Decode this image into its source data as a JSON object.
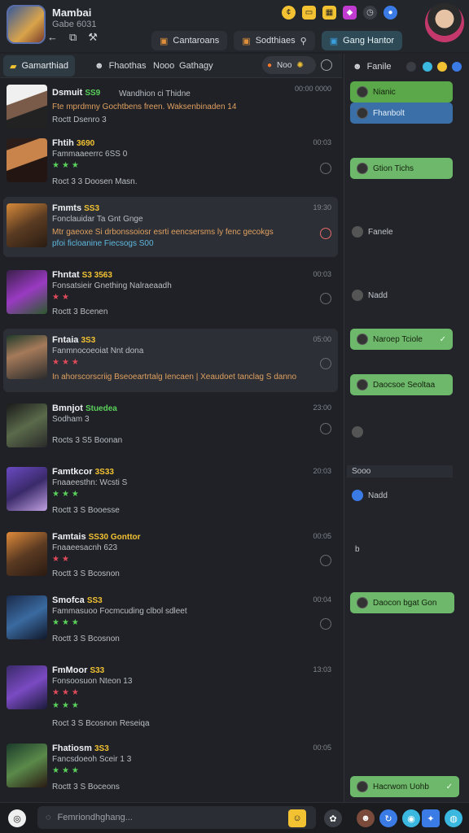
{
  "header": {
    "title": "Mambai",
    "subtitle": "Gabe 6031",
    "toolbar_icons": [
      "back-arrow-icon",
      "filter-icon",
      "hammer-icon"
    ],
    "top_icons": [
      {
        "name": "coin-icon",
        "color": "#f2c233"
      },
      {
        "name": "inbox-icon",
        "color": "#f2c233"
      },
      {
        "name": "grid-icon",
        "color": "#f2c233"
      },
      {
        "name": "store-icon",
        "color": "#c23bd1"
      },
      {
        "name": "clock-icon",
        "color": "#3a3d44"
      },
      {
        "name": "globe-icon",
        "color": "#3b7be6"
      }
    ],
    "tabs": [
      {
        "label": "Cantaroans",
        "active": false
      },
      {
        "label": "Sodthiaes",
        "active": false
      },
      {
        "label": "Gang Hantor",
        "active": true
      }
    ]
  },
  "subtabs": {
    "active": "Gamarthiad",
    "items": [
      "Fhaothas",
      "Nooo",
      "Gathagy"
    ],
    "pill_label": "Noo"
  },
  "list": [
    {
      "name": "Dsmuit",
      "badge": "SS9",
      "line1": "Wandhion ci Thidne",
      "line2": "Fte mprdmny Gochtbens freen. Waksenbinaden 14",
      "line3": "Roctt  Dsenro 3",
      "time": "00:00  0000",
      "stars": 0
    },
    {
      "name": "Fhtih",
      "badge": "3690",
      "line1": "Fammaaeerrc 6SS 0",
      "line2": "",
      "line3": "Roct 3 3  Doosen  Masn.",
      "time": "00:03",
      "stars": 3
    },
    {
      "name": "Fmmts",
      "badge": "SS3",
      "line1": "Fonclauidar Ta Gnt Gnge",
      "line2": "Mtr gaeoxe Si drbonssoiosr esrti eencsersms ly fenc gecokgs",
      "line3": "pfoi ficloanine Fiecsogs S00",
      "time": "19:30",
      "stars": 0
    },
    {
      "name": "Fhntat",
      "badge": "S3 3563",
      "line1": "Fonsatsieir  Gnething Nalraeaadh",
      "line2": "",
      "line3": "Roctt 3  Bcenen",
      "time": "00:03",
      "stars": 2
    },
    {
      "name": "Fntaia",
      "badge": "3S3",
      "line1": "Fanmnocoeoiat Nnt dona",
      "line2": "In ahorscorscriig Bseoeartrtalg Iencaen | Xeaudoet tanclag S danno",
      "line3": "",
      "time": "05:00",
      "stars": 3
    },
    {
      "name": "Bmnjot",
      "badge": "Stuedea",
      "line1": "Sodham 3",
      "line2": "",
      "line3": "Rocts 3 S5  Boonan",
      "time": "23:00",
      "stars": 0
    },
    {
      "name": "Famtkcor",
      "badge": "3S33",
      "line1": "Fnaaeesthn: Wcsti S",
      "line2": "",
      "line3": "Roctt 3 S  Booesse",
      "time": "20:03",
      "stars": 3
    },
    {
      "name": "Famtais",
      "badge": "SS30  Gonttor",
      "line1": "Fnaaeesacnh 623",
      "line2": "",
      "line3": "Roctt 3 S  Bcosnon",
      "time": "00:05",
      "stars": 2
    },
    {
      "name": "Smofca",
      "badge": "SS3",
      "line1": "Fammasuoo Focmcuding  clbol sdleet",
      "line2": "",
      "line3": "Roctt 3 S  Bcosnon",
      "time": "00:04",
      "stars": 3
    },
    {
      "name": "FmMoor",
      "badge": "S33",
      "line1": "Fonsoosuon  Nteon 13",
      "line2": "",
      "line3": "Roct 3 S  Bcosnon  Reseiqa",
      "time": "13:03",
      "stars": 3
    },
    {
      "name": "Fhatiosm",
      "badge": "3S3",
      "line1": "Fancsdoeoh  Sceir 1 3",
      "line2": "",
      "line3": "Roctt 3 S  Boceons",
      "time": "00:05",
      "stars": 3
    }
  ],
  "right_panel": {
    "tab_label": "Fanile",
    "tab_icons": [
      "settings-icon",
      "status-icon",
      "notification-icon",
      "chat-icon"
    ],
    "messages": [
      {
        "text": "Nianic",
        "style": "green-blue"
      },
      {
        "text": "Fhanbolt",
        "style": "blue"
      },
      {
        "text": "Gtion Tichs",
        "style": "green"
      },
      {
        "text": "Fanele",
        "style": "plain"
      },
      {
        "text": "Nadd",
        "style": "plain"
      },
      {
        "text": "Naroep Tciole",
        "style": "green"
      },
      {
        "text": "Daocsoe Seoltaa",
        "style": "green"
      },
      {
        "text": "",
        "style": "plain"
      },
      {
        "text": "Sooo",
        "style": "plain"
      },
      {
        "text": "Nadd",
        "style": "plain-blue"
      },
      {
        "text": "b",
        "style": "plain"
      },
      {
        "text": "Daocon bgat Gon",
        "style": "green"
      },
      {
        "text": "Hacrwom Uohb",
        "style": "green"
      }
    ]
  },
  "bottom": {
    "search_placeholder": "Femriondhghang..."
  }
}
